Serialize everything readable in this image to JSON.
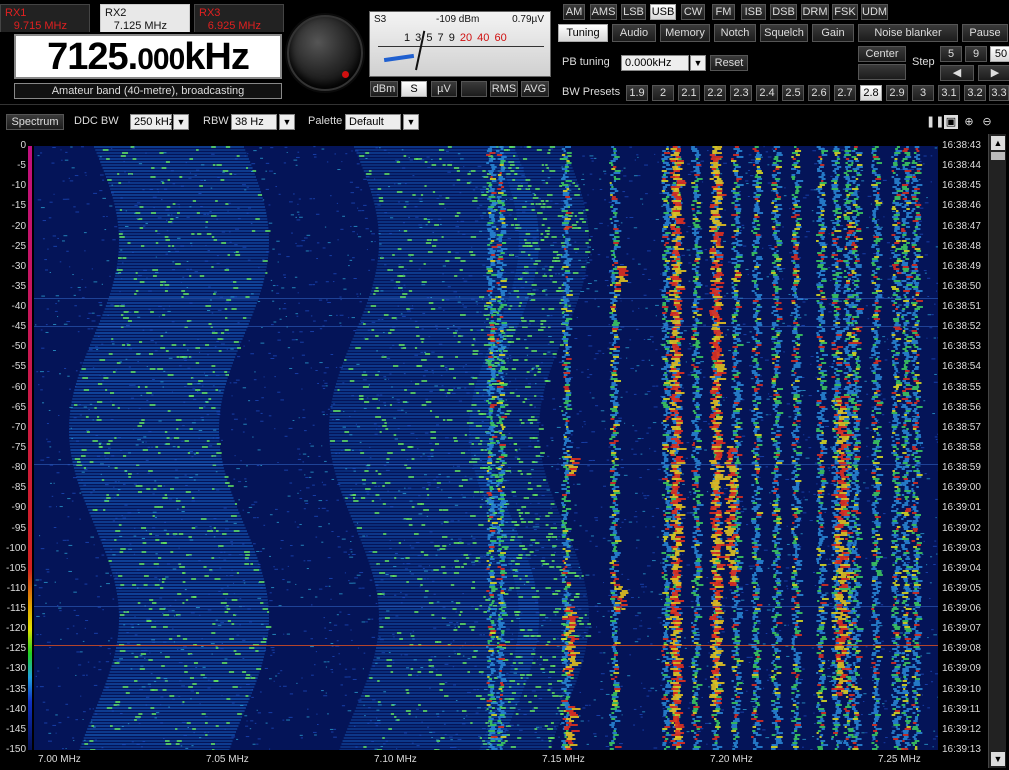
{
  "receivers": [
    {
      "name": "RX1",
      "freq": "9.715 MHz"
    },
    {
      "name": "RX2",
      "freq": "7.125 MHz"
    },
    {
      "name": "RX3",
      "freq": "6.925 MHz"
    }
  ],
  "frequency": {
    "main": "7125.",
    "small": "000",
    "unit": "kHz"
  },
  "band_label": "Amateur band (40-metre), broadcasting",
  "smeter": {
    "s_label": "S3",
    "dbm": "-109 dBm",
    "uv": "0.79µV",
    "scale_black": "1 3 5 7 9",
    "scale_red": "20 40 60",
    "buttons": [
      "dBm",
      "S",
      "µV",
      "",
      "RMS",
      "AVG"
    ]
  },
  "modes": [
    "AM",
    "AMS",
    "LSB",
    "USB",
    "CW",
    "FM",
    "ISB",
    "DSB",
    "DRM",
    "FSK",
    "UDM"
  ],
  "tabs": [
    "Tuning",
    "Audio",
    "Memory",
    "Notch",
    "Squelch",
    "Gain",
    "Noise blanker",
    "Pause"
  ],
  "tuning": {
    "pb_label": "PB tuning",
    "pb_value": "0.000kHz",
    "reset": "Reset",
    "center": "Center",
    "step_label": "Step",
    "steps": [
      "5",
      "9",
      "50"
    ],
    "bw_label": "BW Presets",
    "bw_presets": [
      "1.9",
      "2",
      "2.1",
      "2.2",
      "2.3",
      "2.4",
      "2.5",
      "2.6",
      "2.7",
      "2.8",
      "2.9",
      "3",
      "3.1",
      "3.2",
      "3.3"
    ]
  },
  "toolbar": {
    "spectrum": "Spectrum",
    "ddc_label": "DDC BW",
    "ddc_value": "250 kHz",
    "rbw_label": "RBW",
    "rbw_value": "38 Hz",
    "palette_label": "Palette",
    "palette_value": "Default"
  },
  "y_ticks": [
    "0",
    "-5",
    "-10",
    "-15",
    "-20",
    "-25",
    "-30",
    "-35",
    "-40",
    "-45",
    "-50",
    "-55",
    "-60",
    "-65",
    "-70",
    "-75",
    "-80",
    "-85",
    "-90",
    "-95",
    "-100",
    "-105",
    "-110",
    "-115",
    "-120",
    "-125",
    "-130",
    "-135",
    "-140",
    "-145",
    "-150"
  ],
  "time_ticks": [
    "16:38:43",
    "16:38:44",
    "16:38:45",
    "16:38:46",
    "16:38:47",
    "16:38:48",
    "16:38:49",
    "16:38:50",
    "16:38:51",
    "16:38:52",
    "16:38:53",
    "16:38:54",
    "16:38:55",
    "16:38:56",
    "16:38:57",
    "16:38:58",
    "16:38:59",
    "16:39:00",
    "16:39:01",
    "16:39:02",
    "16:39:03",
    "16:39:04",
    "16:39:05",
    "16:39:06",
    "16:39:07",
    "16:39:08",
    "16:39:09",
    "16:39:10",
    "16:39:11",
    "16:39:12",
    "16:39:13"
  ],
  "x_ticks": [
    "7.00 MHz",
    "7.05 MHz",
    "7.10 MHz",
    "7.15 MHz",
    "7.20 MHz",
    "7.25 MHz"
  ],
  "colors": {
    "accent": "#e02020",
    "waterfall_bg": "#04104a"
  }
}
